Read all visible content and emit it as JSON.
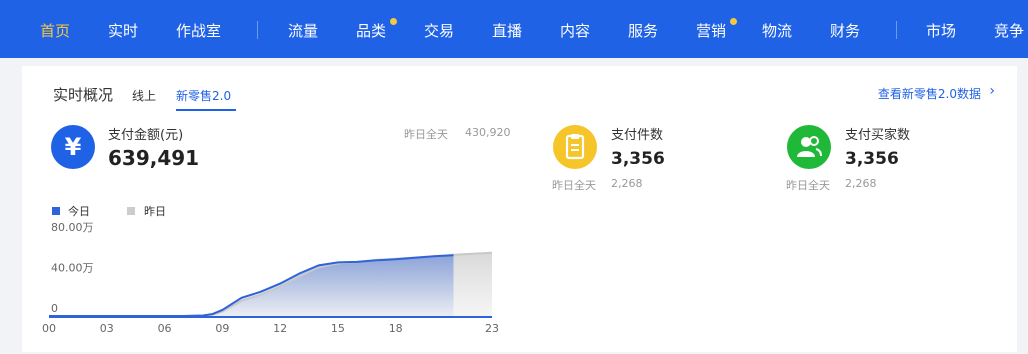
{
  "nav": {
    "items": [
      {
        "label": "首页",
        "active": true,
        "dot": false
      },
      {
        "label": "实时",
        "active": false,
        "dot": false
      },
      {
        "label": "作战室",
        "active": false,
        "dot": false
      },
      {
        "label": "流量",
        "active": false,
        "dot": false
      },
      {
        "label": "品类",
        "active": false,
        "dot": true
      },
      {
        "label": "交易",
        "active": false,
        "dot": false
      },
      {
        "label": "直播",
        "active": false,
        "dot": false
      },
      {
        "label": "内容",
        "active": false,
        "dot": false
      },
      {
        "label": "服务",
        "active": false,
        "dot": false
      },
      {
        "label": "营销",
        "active": false,
        "dot": true
      },
      {
        "label": "物流",
        "active": false,
        "dot": false
      },
      {
        "label": "财务",
        "active": false,
        "dot": false
      },
      {
        "label": "市场",
        "active": false,
        "dot": false
      },
      {
        "label": "竞争",
        "active": false,
        "dot": false
      }
    ]
  },
  "overview": {
    "title": "实时概况",
    "tabs": [
      {
        "label": "线上",
        "active": false
      },
      {
        "label": "新零售2.0",
        "active": true
      }
    ],
    "more_link": "查看新零售2.0数据",
    "more_arrow": "›"
  },
  "metrics": {
    "pay_amount": {
      "icon": "yen-icon",
      "icon_glyph": "¥",
      "label": "支付金额(元)",
      "value": "639,491",
      "yesterday_label": "昨日全天",
      "yesterday_value": "430,920",
      "color": "#2062e6"
    },
    "pay_items": {
      "icon": "clipboard-icon",
      "label": "支付件数",
      "value": "3,356",
      "yesterday_label": "昨日全天",
      "yesterday_value": "2,268",
      "color": "#f5c52a"
    },
    "pay_buyers": {
      "icon": "users-icon",
      "label": "支付买家数",
      "value": "3,356",
      "yesterday_label": "昨日全天",
      "yesterday_value": "2,268",
      "color": "#20b838"
    }
  },
  "legend": {
    "today": "今日",
    "yesterday": "昨日",
    "today_color": "#2f63d9",
    "yesterday_color": "#cccccc"
  },
  "chart_data": {
    "type": "area",
    "x_ticks": [
      "00",
      "03",
      "06",
      "09",
      "12",
      "15",
      "18",
      "23"
    ],
    "y_ticks": [
      "0",
      "40.00万",
      "80.00万"
    ],
    "ylim": [
      0,
      800000
    ],
    "xlim": [
      0,
      23
    ],
    "series": [
      {
        "name": "今日",
        "x": [
          0,
          1,
          2,
          3,
          4,
          5,
          6,
          7,
          8,
          8.5,
          9,
          10,
          11,
          12,
          13,
          14,
          15,
          16,
          17,
          18,
          19,
          20,
          21
        ],
        "values": [
          0,
          0,
          0,
          0,
          0,
          0,
          0,
          0,
          5000,
          20000,
          60000,
          180000,
          240000,
          320000,
          420000,
          500000,
          530000,
          535000,
          550000,
          560000,
          575000,
          590000,
          600000
        ]
      },
      {
        "name": "昨日",
        "x": [
          0,
          1,
          2,
          3,
          4,
          5,
          6,
          7,
          8,
          8.5,
          9,
          10,
          11,
          12,
          13,
          14,
          15,
          16,
          17,
          18,
          19,
          20,
          21,
          22,
          23
        ],
        "values": [
          0,
          0,
          0,
          0,
          0,
          0,
          0,
          0,
          4000,
          15000,
          45000,
          150000,
          210000,
          290000,
          390000,
          480000,
          520000,
          535000,
          555000,
          565000,
          578000,
          590000,
          605000,
          615000,
          625000
        ]
      }
    ]
  }
}
